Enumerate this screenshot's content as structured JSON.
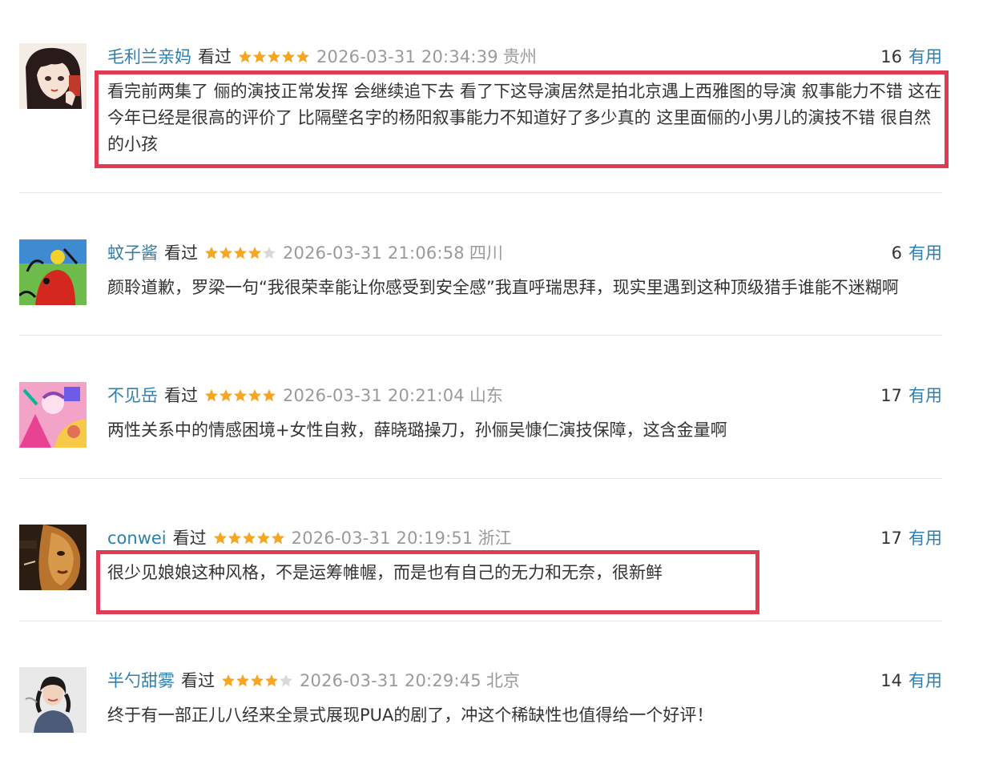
{
  "watched_label": "看过",
  "useful_label": "有用",
  "star_colors": {
    "filled": "#f5a623",
    "empty": "#d9d9d9"
  },
  "highlight_color": "#e03a55",
  "comments": [
    {
      "username": "毛利兰亲妈",
      "rating": 5,
      "time": "2026-03-31 20:34:39",
      "location": "贵州",
      "votes": "16",
      "text": "看完前两集了 俪的演技正常发挥 会继续追下去 看了下这导演居然是拍北京遇上西雅图的导演 叙事能力不错 这在今年已经是很高的评价了 比隔壁名字的杨阳叙事能力不知道好了多少真的 这里面俪的小男儿的演技不错 很自然的小孩",
      "highlighted": true
    },
    {
      "username": "蚊子酱",
      "rating": 4,
      "time": "2026-03-31 21:06:58",
      "location": "四川",
      "votes": "6",
      "text": "颜聆道歉，罗梁一句“我很荣幸能让你感受到安全感”我直呼瑞思拜，现实里遇到这种顶级猎手谁能不迷糊啊",
      "highlighted": false
    },
    {
      "username": "不见岳",
      "rating": 5,
      "time": "2026-03-31 20:21:04",
      "location": "山东",
      "votes": "17",
      "text": "两性关系中的情感困境+女性自救，薛晓璐操刀，孙俪吴慷仁演技保障，这含金量啊",
      "highlighted": false
    },
    {
      "username": "conwei",
      "rating": 5,
      "time": "2026-03-31 20:19:51",
      "location": "浙江",
      "votes": "17",
      "text": "很少见娘娘这种风格，不是运筹帷幄，而是也有自己的无力和无奈，很新鲜",
      "highlighted": true
    },
    {
      "username": "半勺甜雾",
      "rating": 4,
      "time": "2026-03-31 20:29:45",
      "location": "北京",
      "votes": "14",
      "text": "终于有一部正儿八经来全景式展现PUA的剧了，冲这个稀缺性也值得给一个好评！",
      "highlighted": false
    }
  ]
}
